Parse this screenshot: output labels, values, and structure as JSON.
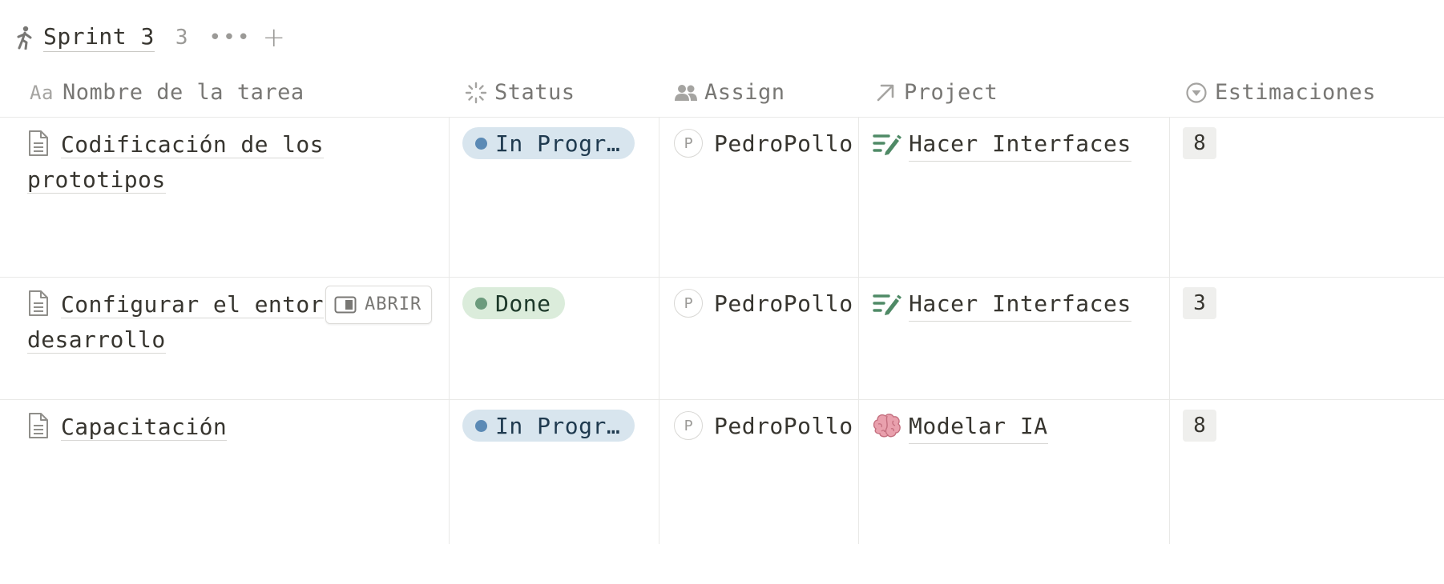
{
  "group": {
    "title": "Sprint 3",
    "count": "3",
    "more_label": "•••",
    "add_label": "+"
  },
  "columns": {
    "name": "Nombre de la tarea",
    "name_icon": "Aa",
    "status": "Status",
    "assign": "Assign",
    "project": "Project",
    "estimate": "Estimaciones"
  },
  "open_button": {
    "label": "ABRIR"
  },
  "rows": [
    {
      "name_line1": "Codificación de los",
      "name_line2": "prototipos",
      "status": "In Progr…",
      "status_type": "in-progress",
      "assign_initial": "P",
      "assign": "PedroPollo",
      "project_icon": "pencil-lines-icon",
      "project": "Hacer Interfaces",
      "estimate": "8"
    },
    {
      "name_line1": "Configurar el entor",
      "name_line2": "desarrollo",
      "status": "Done",
      "status_type": "done",
      "assign_initial": "P",
      "assign": "PedroPollo",
      "project_icon": "pencil-lines-icon",
      "project": "Hacer Interfaces",
      "estimate": "3"
    },
    {
      "name_line1": "Capacitación",
      "status": "In Progr…",
      "status_type": "in-progress",
      "assign_initial": "P",
      "assign": "PedroPollo",
      "project_icon": "brain-icon",
      "project": "Modelar IA",
      "estimate": "8"
    }
  ],
  "colors": {
    "in_progress_bg": "#d8e5ee",
    "in_progress_dot": "#5b8ab5",
    "done_bg": "#dbecdb",
    "done_dot": "#6c9b7d",
    "project_icon_green": "#4f8a66"
  }
}
